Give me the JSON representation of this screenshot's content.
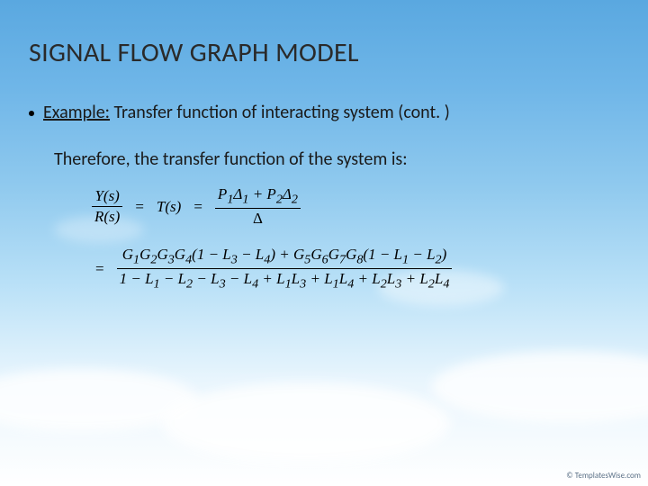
{
  "slide": {
    "title": "SIGNAL FLOW GRAPH MODEL",
    "bullet_prefix": "Example:",
    "bullet_rest": " Transfer function of interacting system (cont. )",
    "paragraph": "Therefore, the transfer function of the system is:",
    "eq1": {
      "lhs_num": "Y(s)",
      "lhs_den": "R(s)",
      "mid": "T(s)",
      "rhs_num_html": "P<sub>1</sub>Δ<sub>1</sub> + P<sub>2</sub>Δ<sub>2</sub>",
      "rhs_den": "Δ"
    },
    "eq2": {
      "num_html": "G<sub>1</sub>G<sub>2</sub>G<sub>3</sub>G<sub>4</sub>(1 − L<sub>3</sub> − L<sub>4</sub>) + G<sub>5</sub>G<sub>6</sub>G<sub>7</sub>G<sub>8</sub>(1 − L<sub>1</sub> − L<sub>2</sub>)",
      "den_html": "1 − L<sub>1</sub> − L<sub>2</sub> − L<sub>3</sub> − L<sub>4</sub> + L<sub>1</sub>L<sub>3</sub> + L<sub>1</sub>L<sub>4</sub> + L<sub>2</sub>L<sub>3</sub> + L<sub>2</sub>L<sub>4</sub>"
    },
    "watermark": "© TemplatesWise.com"
  }
}
